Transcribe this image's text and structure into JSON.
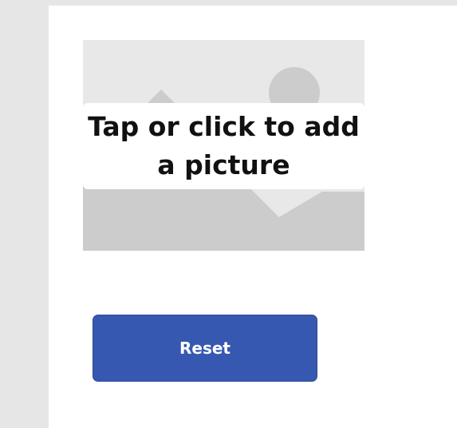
{
  "image_control": {
    "placeholder_text": "Tap or click to add a picture",
    "icon": "image-placeholder-icon",
    "colors": {
      "back": "#e8e8e8",
      "shapes": "#cccccc",
      "overlay": "#ffffff"
    }
  },
  "reset_button": {
    "label": "Reset",
    "color": "#3658b0"
  }
}
